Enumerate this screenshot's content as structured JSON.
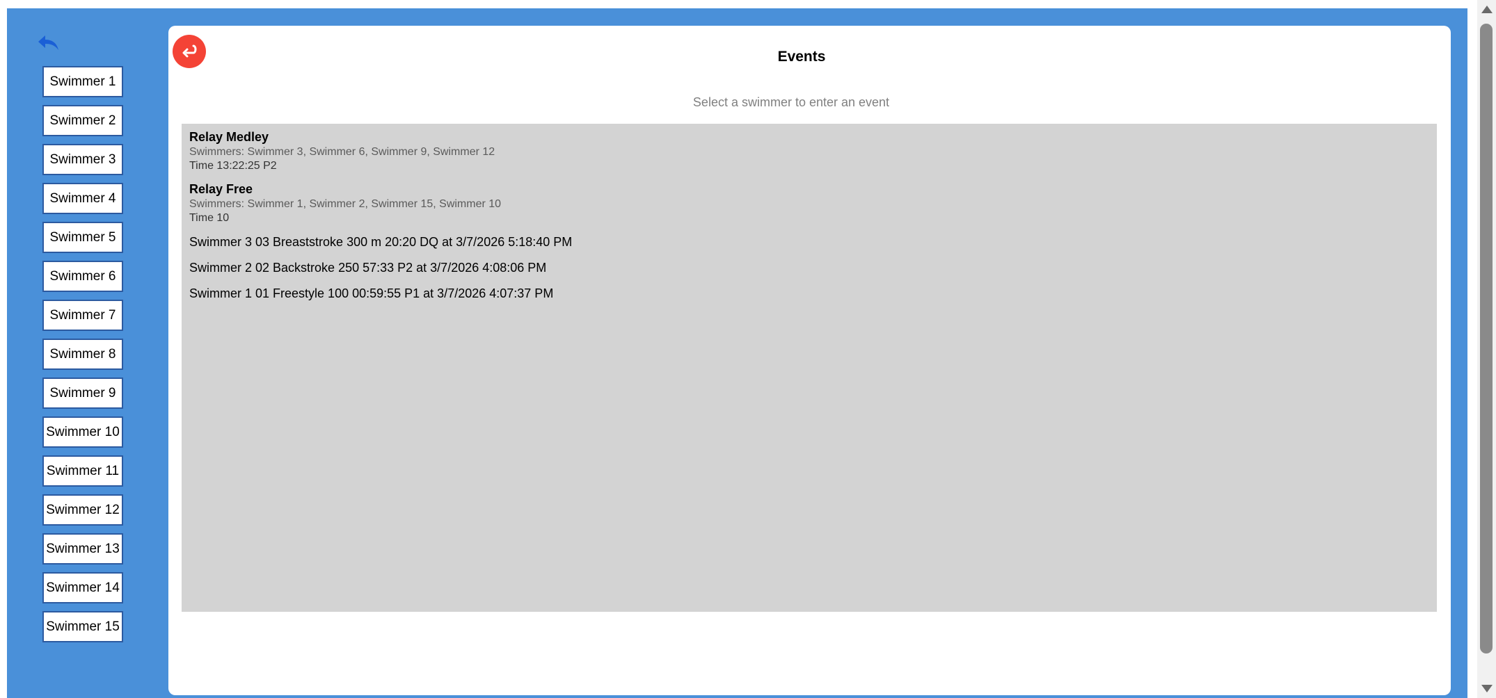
{
  "sidebar": {
    "back_icon": "reply-arrow-icon",
    "swimmers": [
      {
        "label": "Swimmer 1"
      },
      {
        "label": "Swimmer 2"
      },
      {
        "label": "Swimmer 3"
      },
      {
        "label": "Swimmer 4"
      },
      {
        "label": "Swimmer 5"
      },
      {
        "label": "Swimmer 6"
      },
      {
        "label": "Swimmer 7"
      },
      {
        "label": "Swimmer 8"
      },
      {
        "label": "Swimmer 9"
      },
      {
        "label": "Swimmer 10"
      },
      {
        "label": "Swimmer 11"
      },
      {
        "label": "Swimmer 12"
      },
      {
        "label": "Swimmer 13"
      },
      {
        "label": "Swimmer 14"
      },
      {
        "label": "Swimmer 15"
      }
    ]
  },
  "panel": {
    "back_icon": "return-arrow-icon",
    "title": "Events",
    "hint": "Select a swimmer to enter an event",
    "relays": [
      {
        "name": "Relay Medley",
        "swimmers": "Swimmers: Swimmer 3, Swimmer 6, Swimmer 9, Swimmer 12",
        "time": "Time 13:22:25 P2"
      },
      {
        "name": "Relay Free",
        "swimmers": "Swimmers: Swimmer 1, Swimmer 2, Swimmer 15, Swimmer 10",
        "time": "Time 10"
      }
    ],
    "entries": [
      "Swimmer 3 03 Breaststroke 300 m 20:20 DQ at 3/7/2026 5:18:40 PM",
      "Swimmer 2 02 Backstroke 250 57:33 P2 at 3/7/2026 4:08:06 PM",
      "Swimmer 1 01 Freestyle 100 00:59:55 P1 at 3/7/2026 4:07:37 PM"
    ]
  },
  "colors": {
    "app_background": "#4a90d9",
    "back_button": "#f44336",
    "events_box": "#d3d3d3",
    "swimmer_border": "#2c5aa0"
  }
}
